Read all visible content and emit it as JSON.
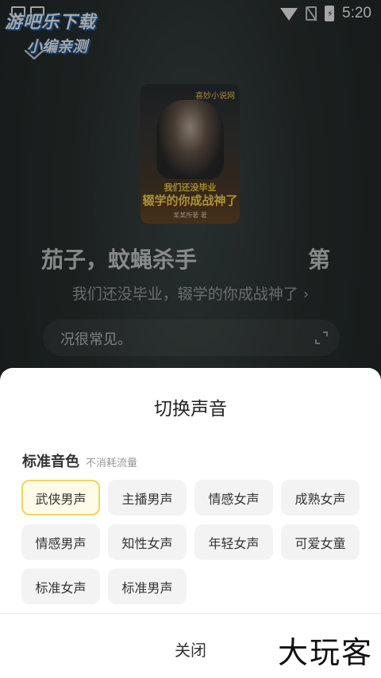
{
  "status_bar": {
    "time": "5:20",
    "battery_glyph": "⚡"
  },
  "watermark": {
    "line1": "游吧乐下载",
    "line2": "小编亲测",
    "corner": "大玩客"
  },
  "player": {
    "cover": {
      "brand": "喜妙小说网",
      "title_line1": "我们还没毕业",
      "title_line2": "辍学的你成战神了",
      "author": "某某所著 著"
    },
    "lyric_left": "茄子，蚊蝇杀手",
    "lyric_right": "第",
    "book_title": "我们还没毕业，辍学的你成战神了",
    "book_arrow": "›",
    "text_preview": "况很常见。"
  },
  "sheet": {
    "title": "切换声音",
    "section_title": "标准音色",
    "section_subtitle": "不消耗流量",
    "voices": [
      "武侠男声",
      "主播男声",
      "情感女声",
      "成熟女声",
      "情感男声",
      "知性女声",
      "年轻女声",
      "可爱女童",
      "标准女声",
      "标准男声"
    ],
    "selected_index": 0,
    "close_label": "关闭"
  },
  "colors": {
    "accent_border": "#f2d460",
    "accent_bg": "#fffbe9"
  }
}
